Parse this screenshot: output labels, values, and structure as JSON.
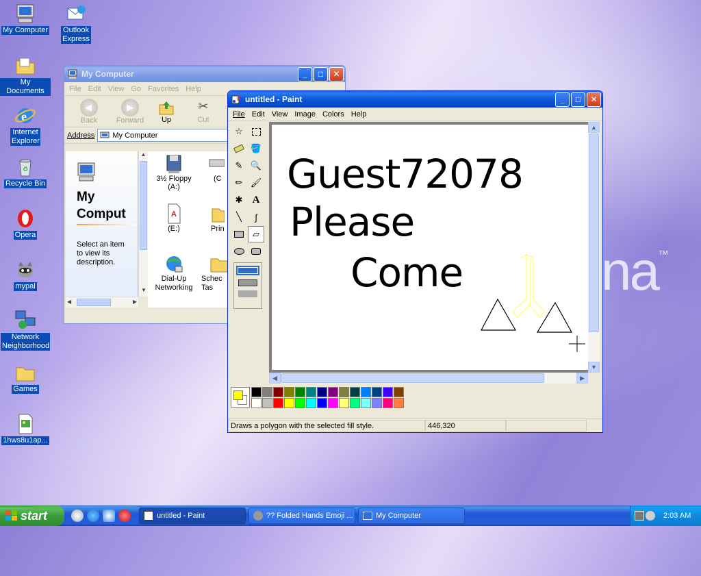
{
  "desktop": {
    "brand_text": "na",
    "brand_mark": "™",
    "icons": [
      {
        "label": "My Computer",
        "icon": "my-computer-icon"
      },
      {
        "label": "Outlook Express",
        "icon": "outlook-express-icon"
      },
      {
        "label": "My Documents",
        "icon": "my-documents-icon"
      },
      {
        "label": "Internet Explorer",
        "icon": "internet-explorer-icon"
      },
      {
        "label": "Recycle Bin",
        "icon": "recycle-bin-icon"
      },
      {
        "label": "Opera",
        "icon": "opera-icon"
      },
      {
        "label": "mypal",
        "icon": "mypal-icon"
      },
      {
        "label": "Network Neighborhood",
        "icon": "network-neighborhood-icon"
      },
      {
        "label": "Games",
        "icon": "games-folder-icon"
      },
      {
        "label": "1hws8u1ap...",
        "icon": "image-file-icon"
      }
    ]
  },
  "my_computer_window": {
    "title": "My Computer",
    "menu": [
      "File",
      "Edit",
      "View",
      "Go",
      "Favorites",
      "Help"
    ],
    "toolbar": {
      "back": "Back",
      "forward": "Forward",
      "up": "Up",
      "cut": "Cut"
    },
    "address_label": "Address",
    "address_value": "My Computer",
    "panel_title": "My Computer",
    "panel_title_visible": "My Comput",
    "panel_text": "Select an item to view its description.",
    "items": [
      {
        "label": "3½ Floppy (A:)",
        "icon": "floppy-drive-icon"
      },
      {
        "label": "(C",
        "icon": "hard-drive-icon"
      },
      {
        "label": "(E:)",
        "icon": "cd-drive-icon"
      },
      {
        "label": "Prin",
        "icon": "printers-folder-icon"
      },
      {
        "label": "Dial-Up Networking",
        "icon": "dial-up-networking-icon"
      },
      {
        "label": "Schec Tas",
        "icon": "scheduled-tasks-icon"
      }
    ]
  },
  "paint_window": {
    "title": "untitled - Paint",
    "menu": [
      "File",
      "Edit",
      "View",
      "Image",
      "Colors",
      "Help"
    ],
    "canvas_text": [
      "Guest72078",
      "Please",
      "Come"
    ],
    "status_text": "Draws a polygon with the selected fill style.",
    "status_coords": "446,320",
    "foreground_color": "#ffff00",
    "background_color": "#ffffff",
    "palette": [
      "#000000",
      "#808080",
      "#800000",
      "#808000",
      "#008000",
      "#008080",
      "#000080",
      "#800080",
      "#808040",
      "#004040",
      "#0080ff",
      "#004080",
      "#4000ff",
      "#804000",
      "#ffffff",
      "#c0c0c0",
      "#ff0000",
      "#ffff00",
      "#00ff00",
      "#00ffff",
      "#0000ff",
      "#ff00ff",
      "#ffff80",
      "#00ff80",
      "#80ffff",
      "#8080ff",
      "#ff0080",
      "#ff8040"
    ]
  },
  "taskbar": {
    "start_label": "start",
    "tasks": [
      {
        "label": "untitled - Paint",
        "icon": "paint-icon"
      },
      {
        "label": "?? Folded Hands Emoji ...",
        "icon": "mypal-icon"
      },
      {
        "label": "My Computer",
        "icon": "my-computer-icon"
      }
    ],
    "clock": "2:03 AM"
  }
}
